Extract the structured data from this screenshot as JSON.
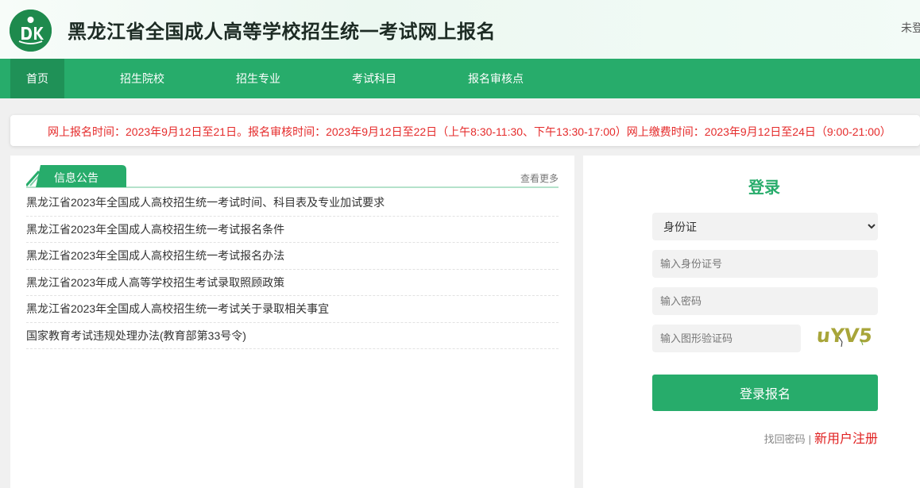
{
  "header": {
    "site_title": "黑龙江省全国成人高等学校招生统一考试网上报名",
    "login_status": "未登"
  },
  "nav": {
    "items": [
      {
        "label": "首页",
        "active": true
      },
      {
        "label": "招生院校"
      },
      {
        "label": "招生专业"
      },
      {
        "label": "考试科目"
      },
      {
        "label": "报名审核点"
      }
    ]
  },
  "notice": {
    "text": "网上报名时间：2023年9月12日至21日。报名审核时间：2023年9月12日至22日（上午8:30-11:30、下午13:30-17:00）网上缴费时间：2023年9月12日至24日（9:00-21:00）"
  },
  "news": {
    "tab_label": "信息公告",
    "more_label": "查看更多",
    "items": [
      "黑龙江省2023年全国成人高校招生统一考试时间、科目表及专业加试要求",
      "黑龙江省2023年全国成人高校招生统一考试报名条件",
      "黑龙江省2023年全国成人高校招生统一考试报名办法",
      "黑龙江省2023年成人高等学校招生考试录取照顾政策",
      "黑龙江省2023年全国成人高校招生统一考试关于录取相关事宜",
      "国家教育考试违规处理办法(教育部第33号令)"
    ]
  },
  "login": {
    "title": "登录",
    "id_type_selected": "身份证",
    "id_placeholder": "输入身份证号",
    "password_placeholder": "输入密码",
    "captcha_placeholder": "输入图形验证码",
    "captcha_text": "uYV5",
    "submit_label": "登录报名",
    "forgot_label": "找回密码",
    "separator": "|",
    "register_label": "新用户注册"
  },
  "colors": {
    "brand_green": "#27ac6b",
    "nav_active": "#1f9157",
    "notice_red": "#e52b2b",
    "register_red": "#e01f1f"
  }
}
